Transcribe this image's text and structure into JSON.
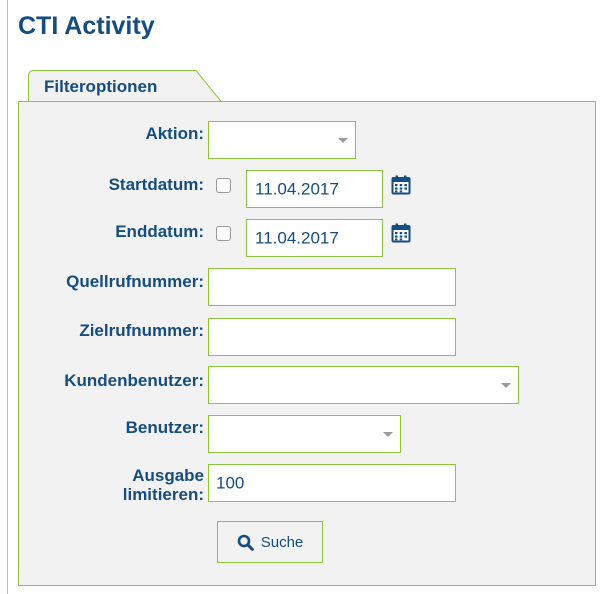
{
  "page": {
    "title": "CTI Activity"
  },
  "tab": {
    "label": "Filteroptionen"
  },
  "form": {
    "aktion": {
      "label": "Aktion:",
      "value": ""
    },
    "startdatum": {
      "label": "Startdatum:",
      "value": "11.04.2017",
      "checked": false
    },
    "enddatum": {
      "label": "Enddatum:",
      "value": "11.04.2017",
      "checked": false
    },
    "quellrufnummer": {
      "label": "Quellrufnummer:",
      "value": ""
    },
    "zielrufnummer": {
      "label": "Zielrufnummer:",
      "value": ""
    },
    "kundenbenutzer": {
      "label": "Kundenbenutzer:",
      "value": ""
    },
    "benutzer": {
      "label": "Benutzer:",
      "value": ""
    },
    "ausgabe": {
      "label_line1": "Ausgabe",
      "label_line2": "limitieren:",
      "value": "100"
    },
    "search_button": {
      "label": "Suche",
      "icon": "search-icon"
    }
  },
  "colors": {
    "brand": "#164d7e",
    "accent": "#8cc63f",
    "panel_bg": "#f2f2f2"
  }
}
